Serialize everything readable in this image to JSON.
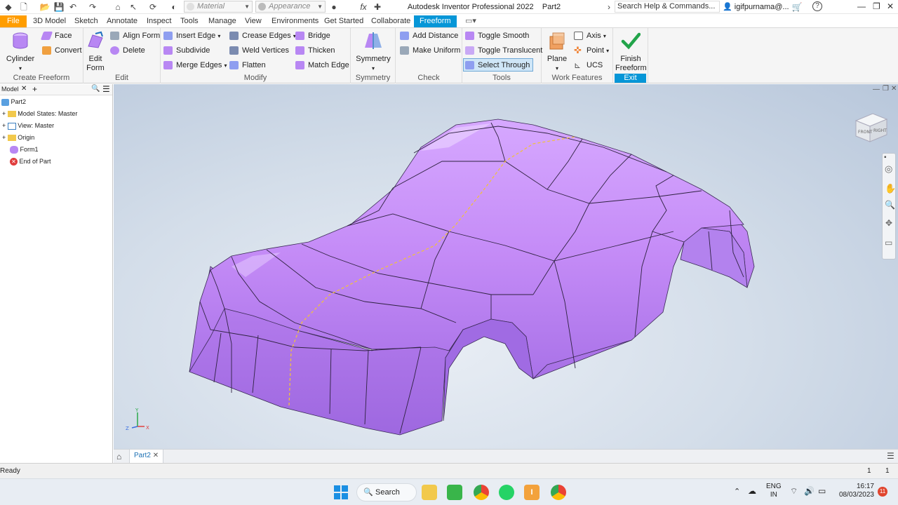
{
  "title_bar": {
    "material_placeholder": "Material",
    "appearance_placeholder": "Appearance",
    "app_title": "Autodesk Inventor Professional 2022",
    "doc_name": "Part2",
    "search_placeholder": "Search Help & Commands...",
    "user": "igifpurnama@...",
    "help": "?"
  },
  "menu": {
    "file": "File",
    "tabs": [
      "3D Model",
      "Sketch",
      "Annotate",
      "Inspect",
      "Tools",
      "Manage",
      "View",
      "Environments",
      "Get Started",
      "Collaborate"
    ],
    "active": "Freeform"
  },
  "ribbon": {
    "create_freeform": {
      "title": "Create Freeform",
      "cylinder": "Cylinder",
      "face": "Face",
      "convert": "Convert"
    },
    "edit": {
      "title": "Edit",
      "edit_form": "Edit Form",
      "align_form": "Align Form",
      "delete": "Delete"
    },
    "modify": {
      "title": "Modify",
      "insert_edge": "Insert Edge",
      "subdivide": "Subdivide",
      "merge_edges": "Merge Edges",
      "crease_edges": "Crease Edges",
      "weld_vertices": "Weld Vertices",
      "flatten": "Flatten",
      "bridge": "Bridge",
      "thicken": "Thicken",
      "match_edge": "Match Edge"
    },
    "symmetry": {
      "title": "Symmetry",
      "symmetry": "Symmetry"
    },
    "check": {
      "title": "Check",
      "add_distance": "Add Distance",
      "make_uniform": "Make Uniform"
    },
    "tools": {
      "title": "Tools",
      "toggle_smooth": "Toggle Smooth",
      "toggle_translucent": "Toggle Translucent",
      "select_through": "Select Through"
    },
    "work_features": {
      "title": "Work Features",
      "plane": "Plane",
      "axis": "Axis",
      "point": "Point",
      "ucs": "UCS"
    },
    "exit": {
      "title": "Exit",
      "finish": "Finish Freeform"
    }
  },
  "browser": {
    "tab": "Model",
    "root": "Part2",
    "items": [
      "Model States: Master",
      "View: Master",
      "Origin",
      "Form1",
      "End of Part"
    ]
  },
  "viewcube": {
    "front": "FRONT",
    "right": "RIGHT"
  },
  "triad": {
    "x": "X",
    "y": "Y",
    "z": "Z"
  },
  "doc_tab": "Part2",
  "status": {
    "text": "Ready",
    "count1": "1",
    "count2": "1"
  },
  "taskbar": {
    "search": "Search",
    "lang": "ENG",
    "region": "IN",
    "time": "16:17",
    "date": "08/03/2023",
    "notif": "11"
  },
  "colors": {
    "accent": "#0696d7",
    "file_tab": "#ff9d00",
    "model": "#c58cf7"
  }
}
